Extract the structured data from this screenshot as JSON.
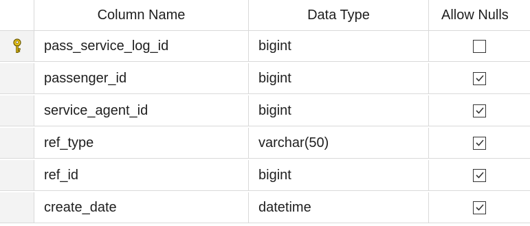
{
  "headers": {
    "column_name": "Column Name",
    "data_type": "Data Type",
    "allow_nulls": "Allow Nulls"
  },
  "rows": [
    {
      "name": "pass_service_log_id",
      "type": "bigint",
      "allow_nulls": false,
      "primary_key": true
    },
    {
      "name": "passenger_id",
      "type": "bigint",
      "allow_nulls": true,
      "primary_key": false
    },
    {
      "name": "service_agent_id",
      "type": "bigint",
      "allow_nulls": true,
      "primary_key": false
    },
    {
      "name": "ref_type",
      "type": "varchar(50)",
      "allow_nulls": true,
      "primary_key": false
    },
    {
      "name": "ref_id",
      "type": "bigint",
      "allow_nulls": true,
      "primary_key": false
    },
    {
      "name": "create_date",
      "type": "datetime",
      "allow_nulls": true,
      "primary_key": false
    }
  ],
  "colors": {
    "key_icon": "#e8c21a",
    "grid_line": "#d9d9d9",
    "selector_bg": "#f3f3f3"
  }
}
